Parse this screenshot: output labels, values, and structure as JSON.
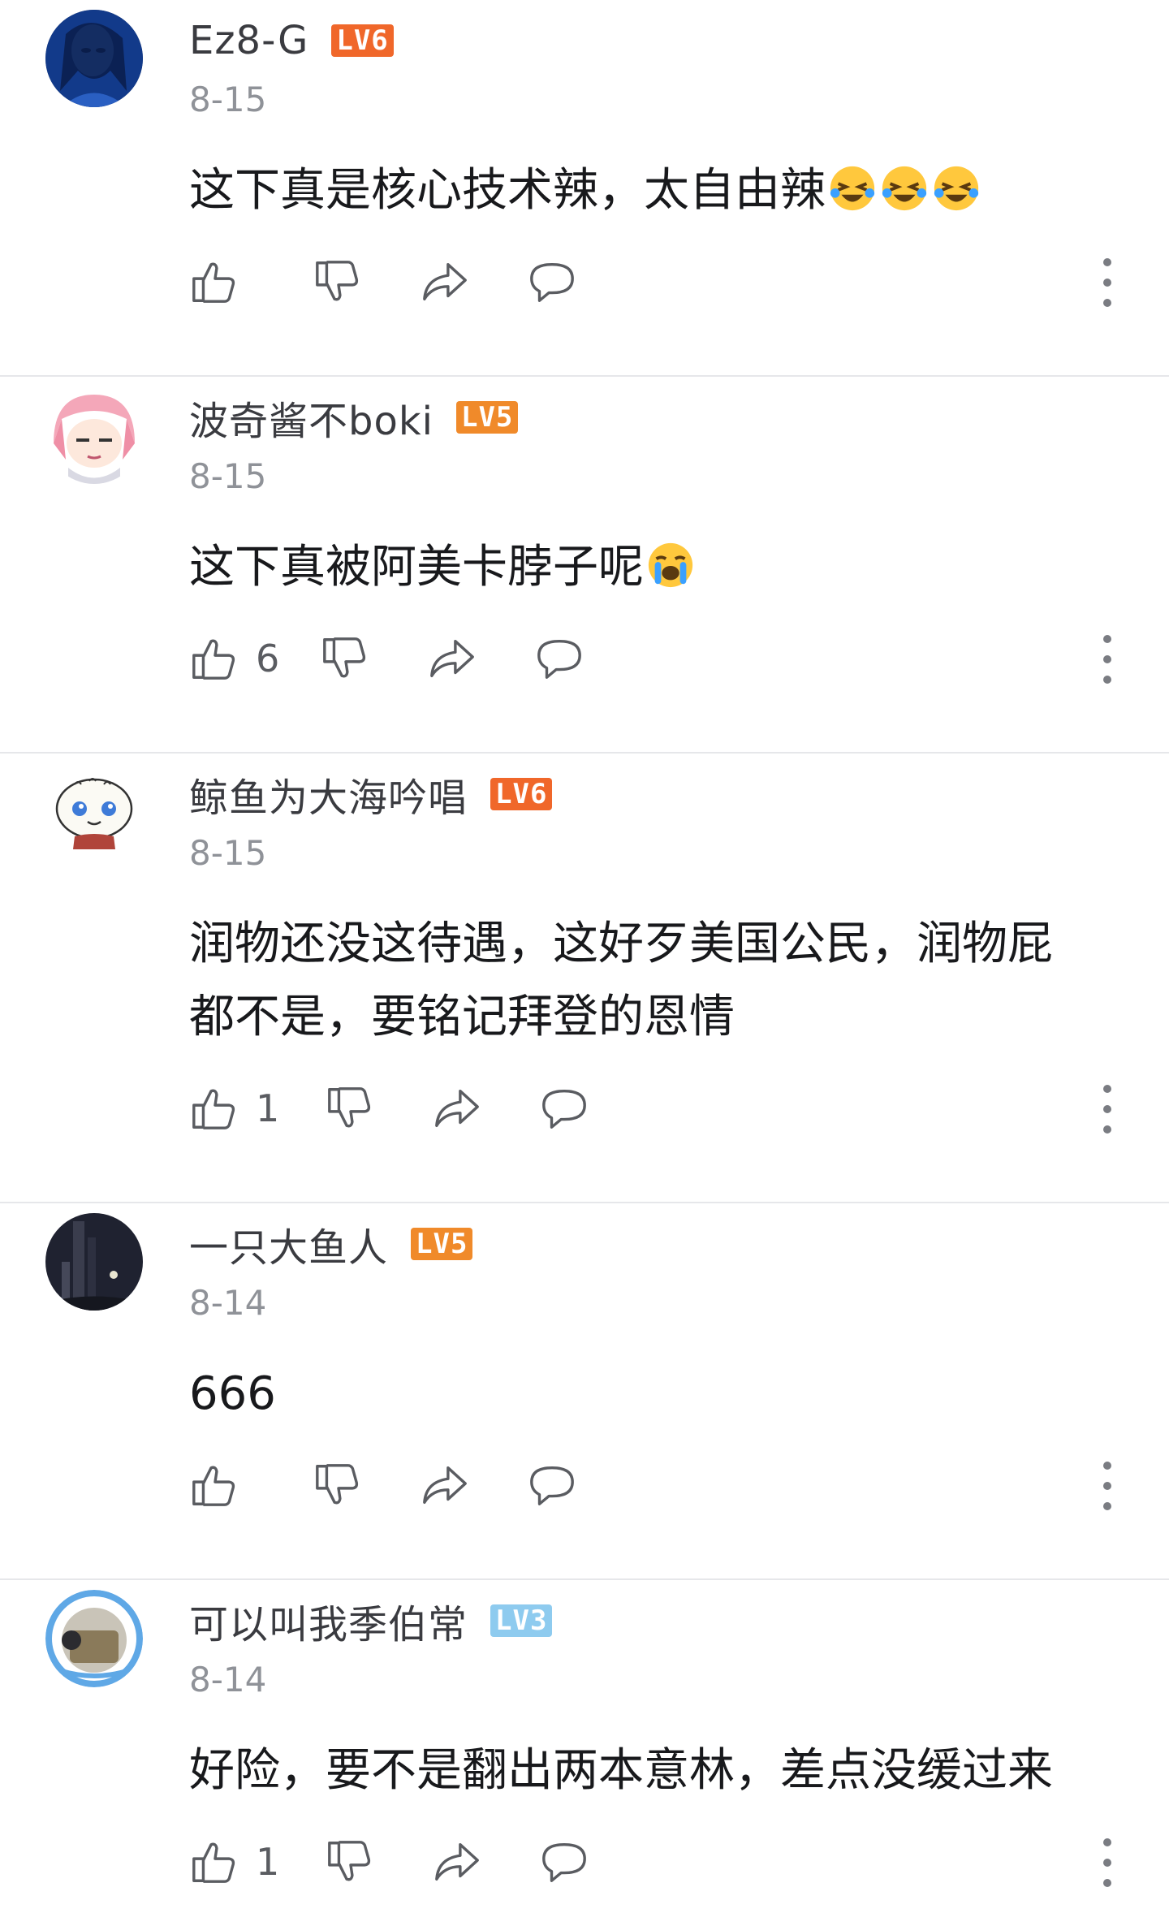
{
  "colors": {
    "lv6": "#f0672a",
    "lv5": "#f08a2a",
    "lv3": "#8ecbef",
    "divider": "#e6e7ea"
  },
  "icons": [
    "thumbs-up-icon",
    "thumbs-down-icon",
    "share-icon",
    "reply-icon",
    "more-icon",
    "laughing-crying-emoji",
    "loudly-crying-emoji"
  ],
  "comments": [
    {
      "username": "Ez8-G",
      "level": "LV6",
      "date": "8-15",
      "text": "这下真是核心技术辣，太自由辣",
      "emojis": [
        "laughing-crying-emoji",
        "laughing-crying-emoji",
        "laughing-crying-emoji"
      ],
      "likes": ""
    },
    {
      "username": "波奇酱不boki",
      "level": "LV5",
      "date": "8-15",
      "text": "这下真被阿美卡脖子呢",
      "emojis": [
        "loudly-crying-emoji"
      ],
      "likes": "6"
    },
    {
      "username": "鲸鱼为大海吟唱",
      "level": "LV6",
      "date": "8-15",
      "text": "润物还没这待遇，这好歹美国公民，润物屁\n都不是，要铭记拜登的恩情",
      "emojis": [],
      "likes": "1"
    },
    {
      "username": "一只大鱼人",
      "level": "LV5",
      "date": "8-14",
      "text": "666",
      "emojis": [],
      "likes": ""
    },
    {
      "username": "可以叫我季伯常",
      "level": "LV3",
      "date": "8-14",
      "text": "好险，要不是翻出两本意林，差点没缓过来",
      "emojis": [],
      "likes": "1"
    }
  ]
}
